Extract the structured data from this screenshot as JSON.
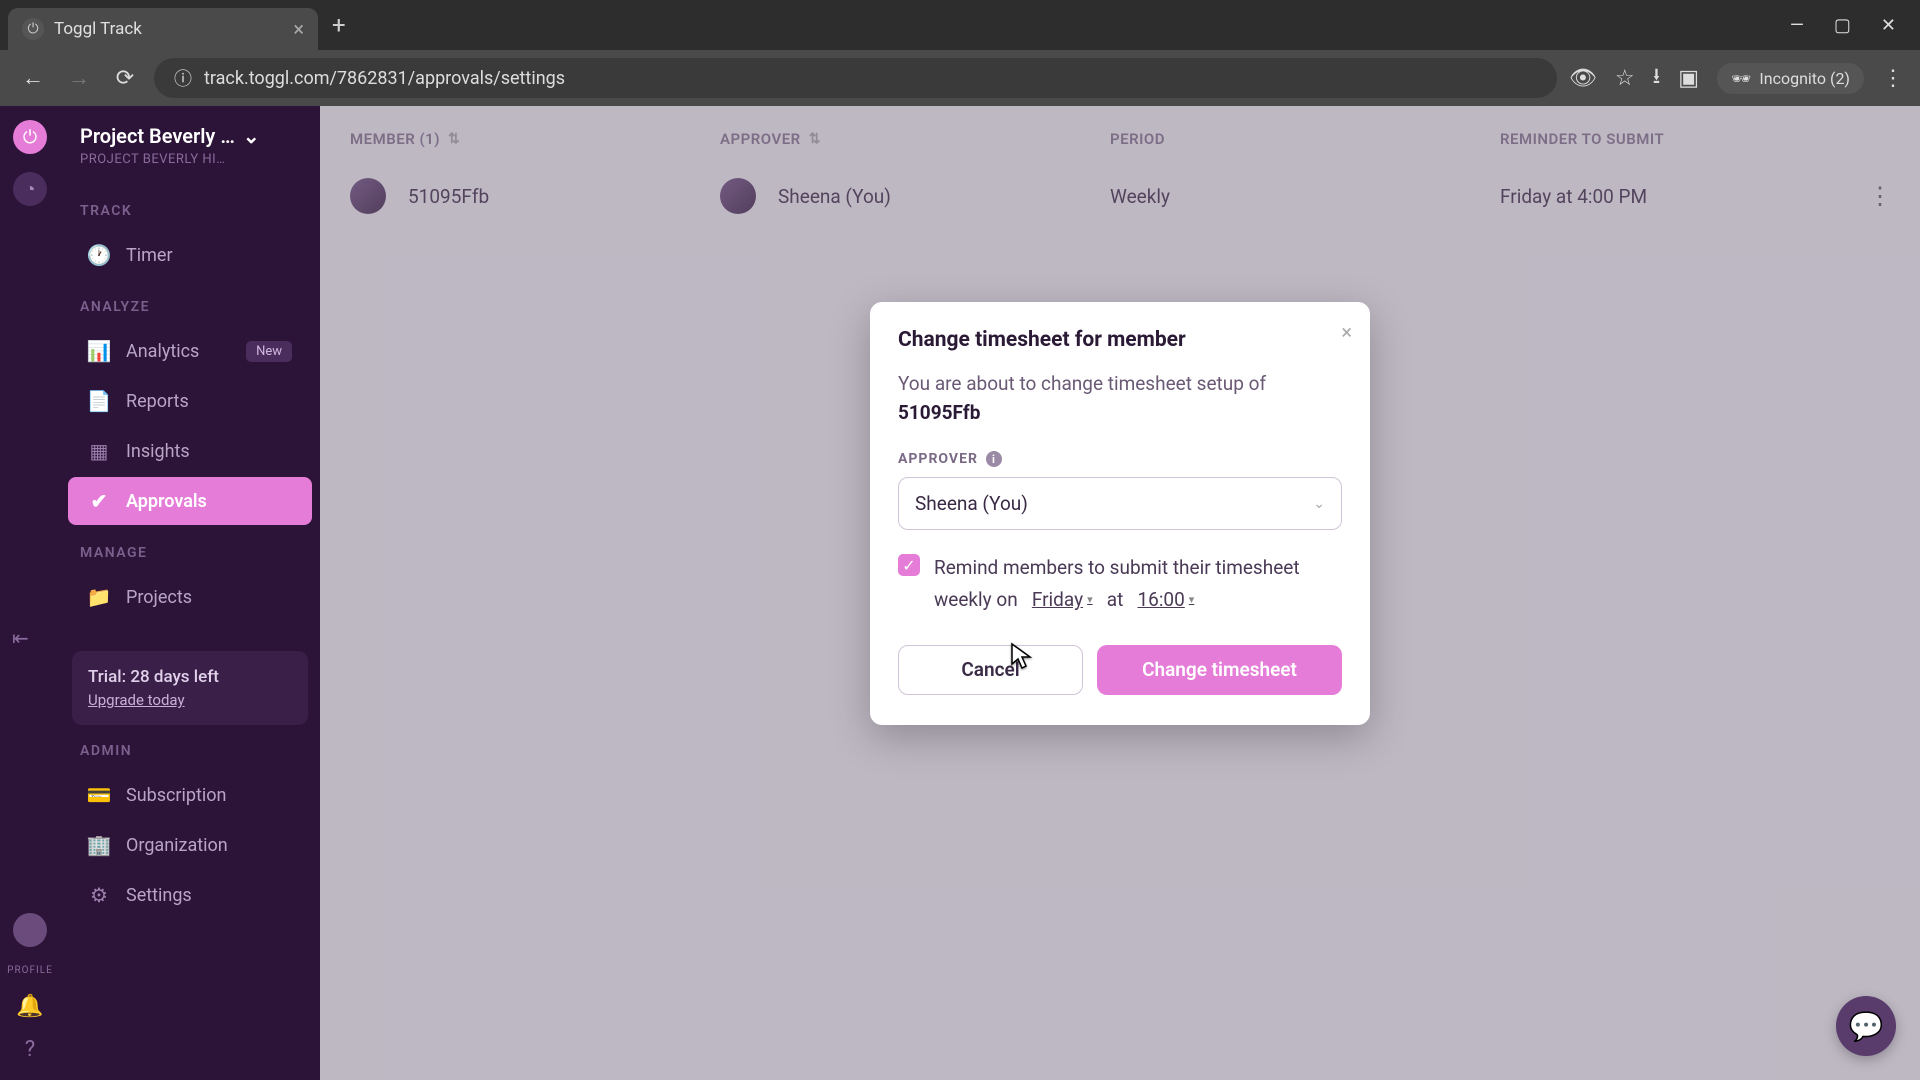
{
  "browser": {
    "tab_title": "Toggl Track",
    "url": "track.toggl.com/7862831/approvals/settings",
    "incognito": "Incognito (2)"
  },
  "workspace": {
    "name": "Project Beverly …",
    "sub": "PROJECT BEVERLY HI…"
  },
  "sidebar": {
    "track_label": "TRACK",
    "timer": "Timer",
    "analyze_label": "ANALYZE",
    "analytics": "Analytics",
    "analytics_badge": "New",
    "reports": "Reports",
    "insights": "Insights",
    "approvals": "Approvals",
    "manage_label": "MANAGE",
    "projects": "Projects",
    "admin_label": "ADMIN",
    "subscription": "Subscription",
    "organization": "Organization",
    "settings": "Settings",
    "trial_title": "Trial: 28 days left",
    "trial_link": "Upgrade today",
    "profile_label": "PROFILE"
  },
  "table": {
    "headers": {
      "member": "MEMBER (1)",
      "approver": "APPROVER",
      "period": "PERIOD",
      "reminder": "REMINDER TO SUBMIT"
    },
    "row": {
      "member": "51095Ffb",
      "approver": "Sheena (You)",
      "period": "Weekly",
      "reminder": "Friday at 4:00 PM"
    }
  },
  "modal": {
    "title": "Change timesheet for member",
    "body_prefix": "You are about to change timesheet setup of ",
    "body_name": "51095Ffb",
    "approver_label": "APPROVER",
    "approver_value": "Sheena (You)",
    "remind_text_1": "Remind members to submit their timesheet weekly on",
    "remind_day": "Friday",
    "remind_at": "at",
    "remind_time": "16:00",
    "cancel": "Cancel",
    "confirm": "Change timesheet"
  }
}
